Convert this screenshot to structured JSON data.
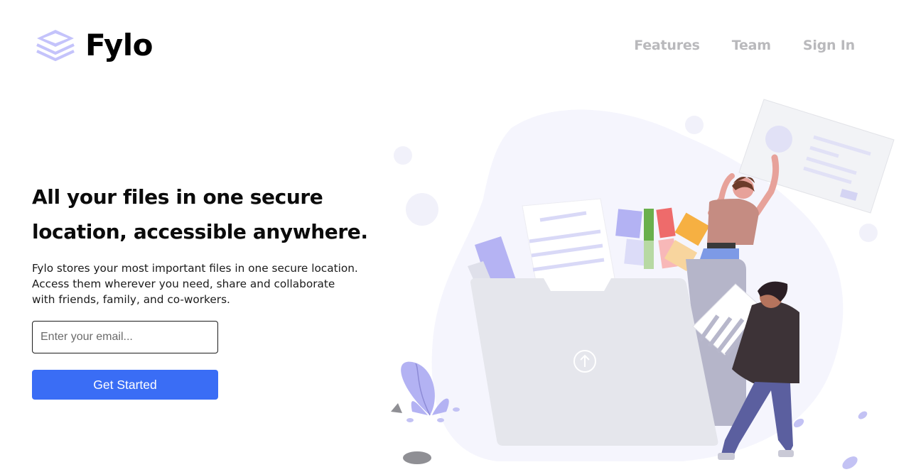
{
  "brand": {
    "name": "Fylo",
    "accent_color": "#3a6df5",
    "logo_color": "#c4c3fb"
  },
  "nav": {
    "items": [
      {
        "label": "Features"
      },
      {
        "label": "Team"
      },
      {
        "label": "Sign In"
      }
    ]
  },
  "hero": {
    "title": "All your files in one secure location, accessible anywhere.",
    "description": "Fylo stores your most important files in one secure location. Access them wherever you need, share and collaborate with friends, family, and co-workers.",
    "email_placeholder": "Enter your email...",
    "cta_label": "Get Started"
  },
  "illustration": {
    "icon": "upload-icon"
  }
}
